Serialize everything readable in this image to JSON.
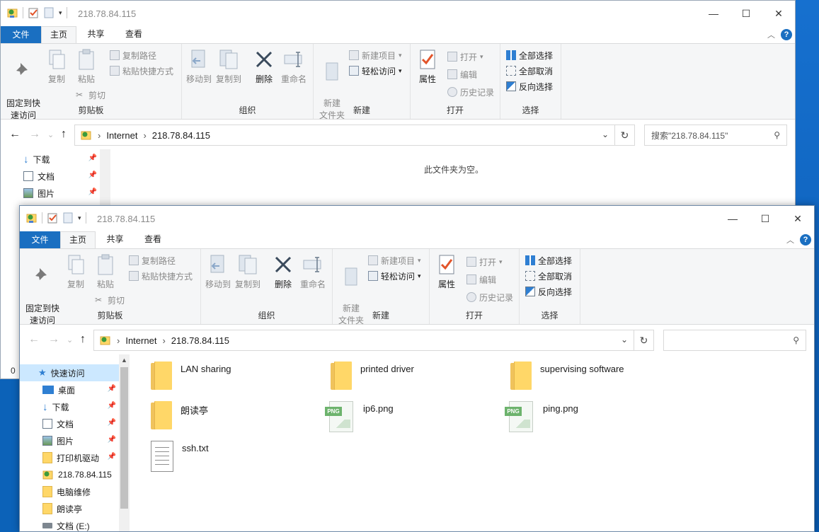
{
  "colors": {
    "accent": "#1a6fc1",
    "desktop": "#0c62b8",
    "folder": "#ffd768"
  },
  "back_window": {
    "title": "218.78.84.115",
    "tabs": {
      "file": "文件",
      "home": "主页",
      "share": "共享",
      "view": "查看"
    },
    "ribbon": {
      "pin": "固定到快\n速访问",
      "copy": "复制",
      "paste": "粘贴",
      "copy_path": "复制路径",
      "paste_shortcut": "粘贴快捷方式",
      "cut": "剪切",
      "clipboard": "剪贴板",
      "move_to": "移动到",
      "copy_to": "复制到",
      "delete": "删除",
      "rename": "重命名",
      "organize": "组织",
      "new_folder": "新建\n文件夹",
      "new_item": "新建项目",
      "easy_access": "轻松访问",
      "new": "新建",
      "properties": "属性",
      "open": "打开",
      "edit": "编辑",
      "history": "历史记录",
      "open_group": "打开",
      "select_all": "全部选择",
      "select_none": "全部取消",
      "invert": "反向选择",
      "select": "选择"
    },
    "address": {
      "crumb1": "Internet",
      "crumb2": "218.78.84.115"
    },
    "search_placeholder": "搜索\"218.78.84.115\"",
    "nav": [
      {
        "label": "下载",
        "icon": "download-arrow-icon"
      },
      {
        "label": "文档",
        "icon": "document-icon"
      },
      {
        "label": "图片",
        "icon": "pictures-icon"
      }
    ],
    "empty_text": "此文件夹为空。",
    "status_count": "0"
  },
  "front_window": {
    "title": "218.78.84.115",
    "tabs": {
      "file": "文件",
      "home": "主页",
      "share": "共享",
      "view": "查看"
    },
    "ribbon": {
      "pin": "固定到快\n速访问",
      "copy": "复制",
      "paste": "粘贴",
      "copy_path": "复制路径",
      "paste_shortcut": "粘贴快捷方式",
      "cut": "剪切",
      "clipboard": "剪贴板",
      "move_to": "移动到",
      "copy_to": "复制到",
      "delete": "删除",
      "rename": "重命名",
      "organize": "组织",
      "new_folder": "新建\n文件夹",
      "new_item": "新建项目",
      "easy_access": "轻松访问",
      "new": "新建",
      "properties": "属性",
      "open": "打开",
      "edit": "编辑",
      "history": "历史记录",
      "open_group": "打开",
      "select_all": "全部选择",
      "select_none": "全部取消",
      "invert": "反向选择",
      "select": "选择"
    },
    "address": {
      "crumb1": "Internet",
      "crumb2": "218.78.84.115"
    },
    "search_placeholder": "",
    "nav": [
      {
        "label": "快速访问",
        "icon": "star-icon",
        "pinned": false
      },
      {
        "label": "桌面",
        "icon": "desktop-icon",
        "pinned": true
      },
      {
        "label": "下载",
        "icon": "download-arrow-icon",
        "pinned": true
      },
      {
        "label": "文档",
        "icon": "document-icon",
        "pinned": true
      },
      {
        "label": "图片",
        "icon": "pictures-icon",
        "pinned": true
      },
      {
        "label": "打印机驱动",
        "icon": "folder-icon",
        "pinned": true
      },
      {
        "label": "218.78.84.115",
        "icon": "network-folder-icon",
        "pinned": false
      },
      {
        "label": "电脑维修",
        "icon": "folder-icon",
        "pinned": false
      },
      {
        "label": "朗读亭",
        "icon": "folder-icon",
        "pinned": false
      },
      {
        "label": "文档 (E:)",
        "icon": "drive-icon",
        "pinned": false
      }
    ],
    "files": [
      {
        "name": "LAN sharing",
        "type": "folder"
      },
      {
        "name": "printed driver",
        "type": "folder"
      },
      {
        "name": "supervising software",
        "type": "folder"
      },
      {
        "name": "朗读亭",
        "type": "folder"
      },
      {
        "name": "ip6.png",
        "type": "png"
      },
      {
        "name": "ping.png",
        "type": "png"
      },
      {
        "name": "ssh.txt",
        "type": "txt"
      }
    ],
    "png_tag": "PNG"
  }
}
